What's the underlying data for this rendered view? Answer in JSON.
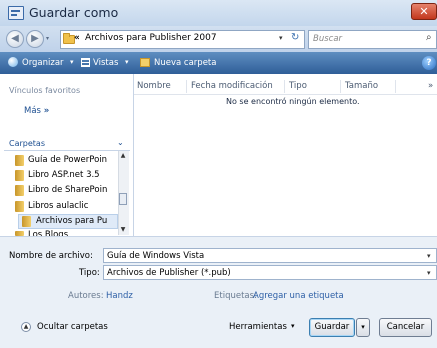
{
  "window": {
    "title": "Guardar como",
    "close_symbol": "✕"
  },
  "address": {
    "chevron": "«",
    "path": "Archivos para Publisher 2007",
    "search_placeholder": "Buscar",
    "back_symbol": "◀",
    "forward_symbol": "▶",
    "dropdown_symbol": "▾",
    "refresh_symbol": "↻",
    "search_symbol": "⌕"
  },
  "toolbar": {
    "organize": "Organizar",
    "views": "Vistas",
    "new_folder": "Nueva carpeta",
    "help": "?",
    "dropdown_symbol": "▾"
  },
  "left_pane": {
    "favorites_header": "Vínculos favoritos",
    "more_label": "Más",
    "more_symbol": "»",
    "folders_header": "Carpetas",
    "folders_chevron": "⌄",
    "tree": [
      "Guía de PowerPoin",
      "Libro ASP.net 3.5",
      "Libro de SharePoin",
      "Libros aulaclic",
      "Archivos para Pu",
      "Los Blogs"
    ],
    "scroll_up": "▲",
    "scroll_down": "▼"
  },
  "file_list": {
    "columns": [
      "Nombre",
      "Fecha modificación",
      "Tipo",
      "Tamaño"
    ],
    "more_columns": "»",
    "empty_message": "No se encontró ningún elemento."
  },
  "form": {
    "filename_label": "Nombre de archivo:",
    "filename_value": "Guía de Windows Vista",
    "type_label": "Tipo:",
    "type_value": "Archivos de Publisher (*.pub)",
    "authors_label": "Autores:",
    "authors_value": "Handz",
    "tags_label": "Etiquetas:",
    "tags_value": "Agregar una etiqueta",
    "dropdown_symbol": "▾"
  },
  "footer": {
    "hide_folders": "Ocultar carpetas",
    "tools": "Herramientas",
    "save": "Guardar",
    "cancel": "Cancelar",
    "dropdown_symbol": "▾",
    "hide_symbol": "▲"
  }
}
